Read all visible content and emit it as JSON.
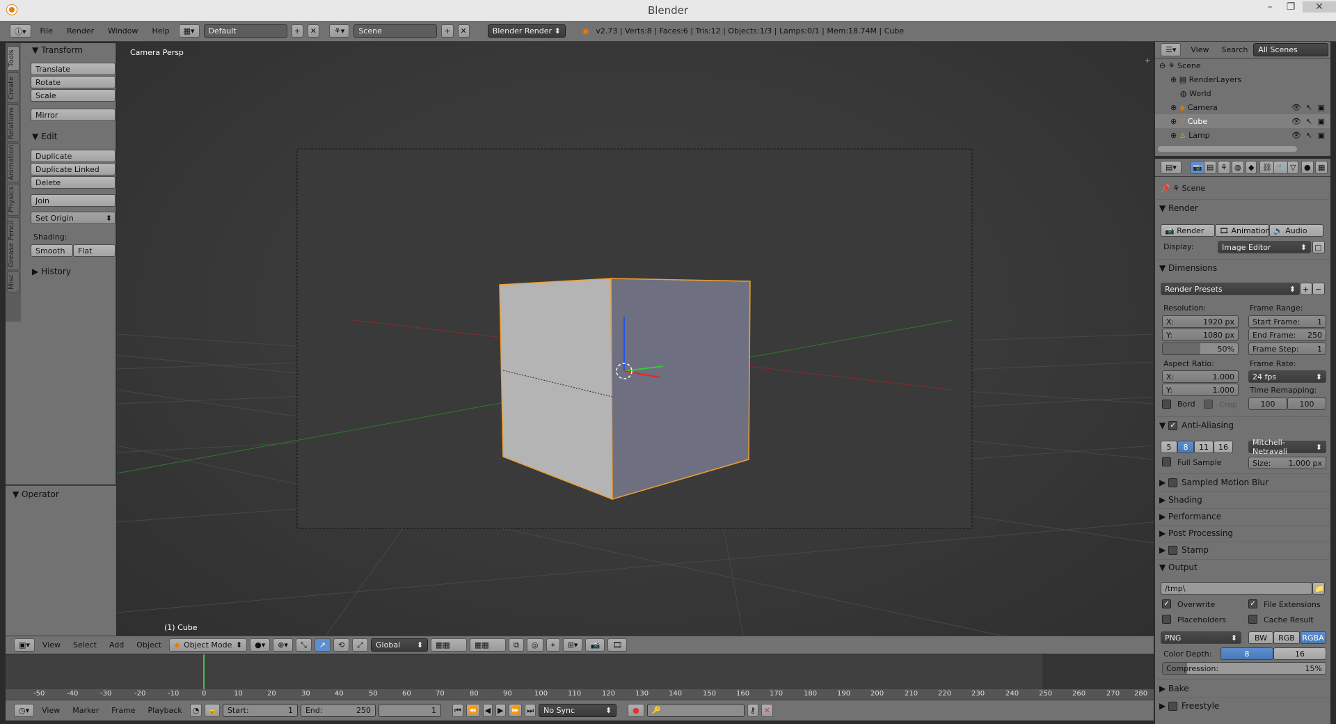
{
  "window": {
    "title": "Blender"
  },
  "topbar": {
    "menus": [
      "File",
      "Render",
      "Window",
      "Help"
    ],
    "screen_layout": "Default",
    "scene": "Scene",
    "engine": "Blender Render",
    "stats": "v2.73 | Verts:8 | Faces:6 | Tris:12 | Objects:1/3 | Lamps:0/1 | Mem:18.74M | Cube"
  },
  "toolshelf": {
    "tabs": [
      "Tools",
      "Create",
      "Relations",
      "Animation",
      "Physics",
      "Grease Pencil",
      "Misc"
    ],
    "transform": {
      "title": "Transform",
      "buttons": [
        "Translate",
        "Rotate",
        "Scale",
        "Mirror"
      ]
    },
    "edit": {
      "title": "Edit",
      "buttons": [
        "Duplicate",
        "Duplicate Linked",
        "Delete",
        "Join"
      ],
      "set_origin": "Set Origin",
      "shading_label": "Shading:",
      "smooth": "Smooth",
      "flat": "Flat"
    },
    "history": {
      "title": "History"
    },
    "operator": {
      "title": "Operator"
    }
  },
  "viewport": {
    "view_label": "Camera Persp",
    "object_label": "(1) Cube",
    "header": {
      "menus": [
        "View",
        "Select",
        "Add",
        "Object"
      ],
      "mode": "Object Mode",
      "orientation": "Global"
    }
  },
  "timeline": {
    "ticks": [
      "-50",
      "-40",
      "-30",
      "-20",
      "-10",
      "0",
      "10",
      "20",
      "30",
      "40",
      "50",
      "60",
      "70",
      "80",
      "90",
      "100",
      "110",
      "120",
      "130",
      "140",
      "150",
      "160",
      "170",
      "180",
      "190",
      "200",
      "210",
      "220",
      "230",
      "240",
      "250",
      "260",
      "270",
      "280"
    ],
    "menus": [
      "View",
      "Marker",
      "Frame",
      "Playback"
    ],
    "start_label": "Start:",
    "start": "1",
    "end_label": "End:",
    "end": "250",
    "current": "1",
    "sync": "No Sync"
  },
  "outliner": {
    "menus": [
      "View",
      "Search"
    ],
    "filter": "All Scenes",
    "items": [
      "Scene",
      "RenderLayers",
      "World",
      "Camera",
      "Cube",
      "Lamp"
    ]
  },
  "properties": {
    "context": "Scene",
    "render": {
      "title": "Render",
      "buttons": [
        "Render",
        "Animation",
        "Audio"
      ],
      "display_label": "Display:",
      "display": "Image Editor"
    },
    "dimensions": {
      "title": "Dimensions",
      "presets": "Render Presets",
      "resolution_label": "Resolution:",
      "res_x_label": "X:",
      "res_x": "1920 px",
      "res_y_label": "Y:",
      "res_y": "1080 px",
      "res_pct": "50%",
      "frame_range_label": "Frame Range:",
      "start_label": "Start Frame:",
      "start": "1",
      "end_label": "End Frame:",
      "end": "250",
      "step_label": "Frame Step:",
      "step": "1",
      "aspect_label": "Aspect Ratio:",
      "asp_x_label": "X:",
      "asp_x": "1.000",
      "asp_y_label": "Y:",
      "asp_y": "1.000",
      "frame_rate_label": "Frame Rate:",
      "fps": "24 fps",
      "time_remap_label": "Time Remapping:",
      "remap_old": "100",
      "remap_new": "100",
      "border": "Bord",
      "crop": "Crop"
    },
    "aa": {
      "title": "Anti-Aliasing",
      "samples": [
        "5",
        "8",
        "11",
        "16"
      ],
      "filter": "Mitchell-Netravali",
      "full_sample": "Full Sample",
      "size_label": "Size:",
      "size": "1.000 px"
    },
    "panels": [
      "Sampled Motion Blur",
      "Shading",
      "Performance",
      "Post Processing",
      "Stamp"
    ],
    "output": {
      "title": "Output",
      "path": "/tmp\\",
      "overwrite": "Overwrite",
      "file_ext": "File Extensions",
      "placeholders": "Placeholders",
      "cache": "Cache Result",
      "format": "PNG",
      "channels": [
        "BW",
        "RGB",
        "RGBA"
      ],
      "depth_label": "Color Depth:",
      "depths": [
        "8",
        "16"
      ],
      "compression_label": "Compression:",
      "compression": "15%"
    },
    "bottom_panels": [
      "Bake",
      "Freestyle"
    ]
  }
}
